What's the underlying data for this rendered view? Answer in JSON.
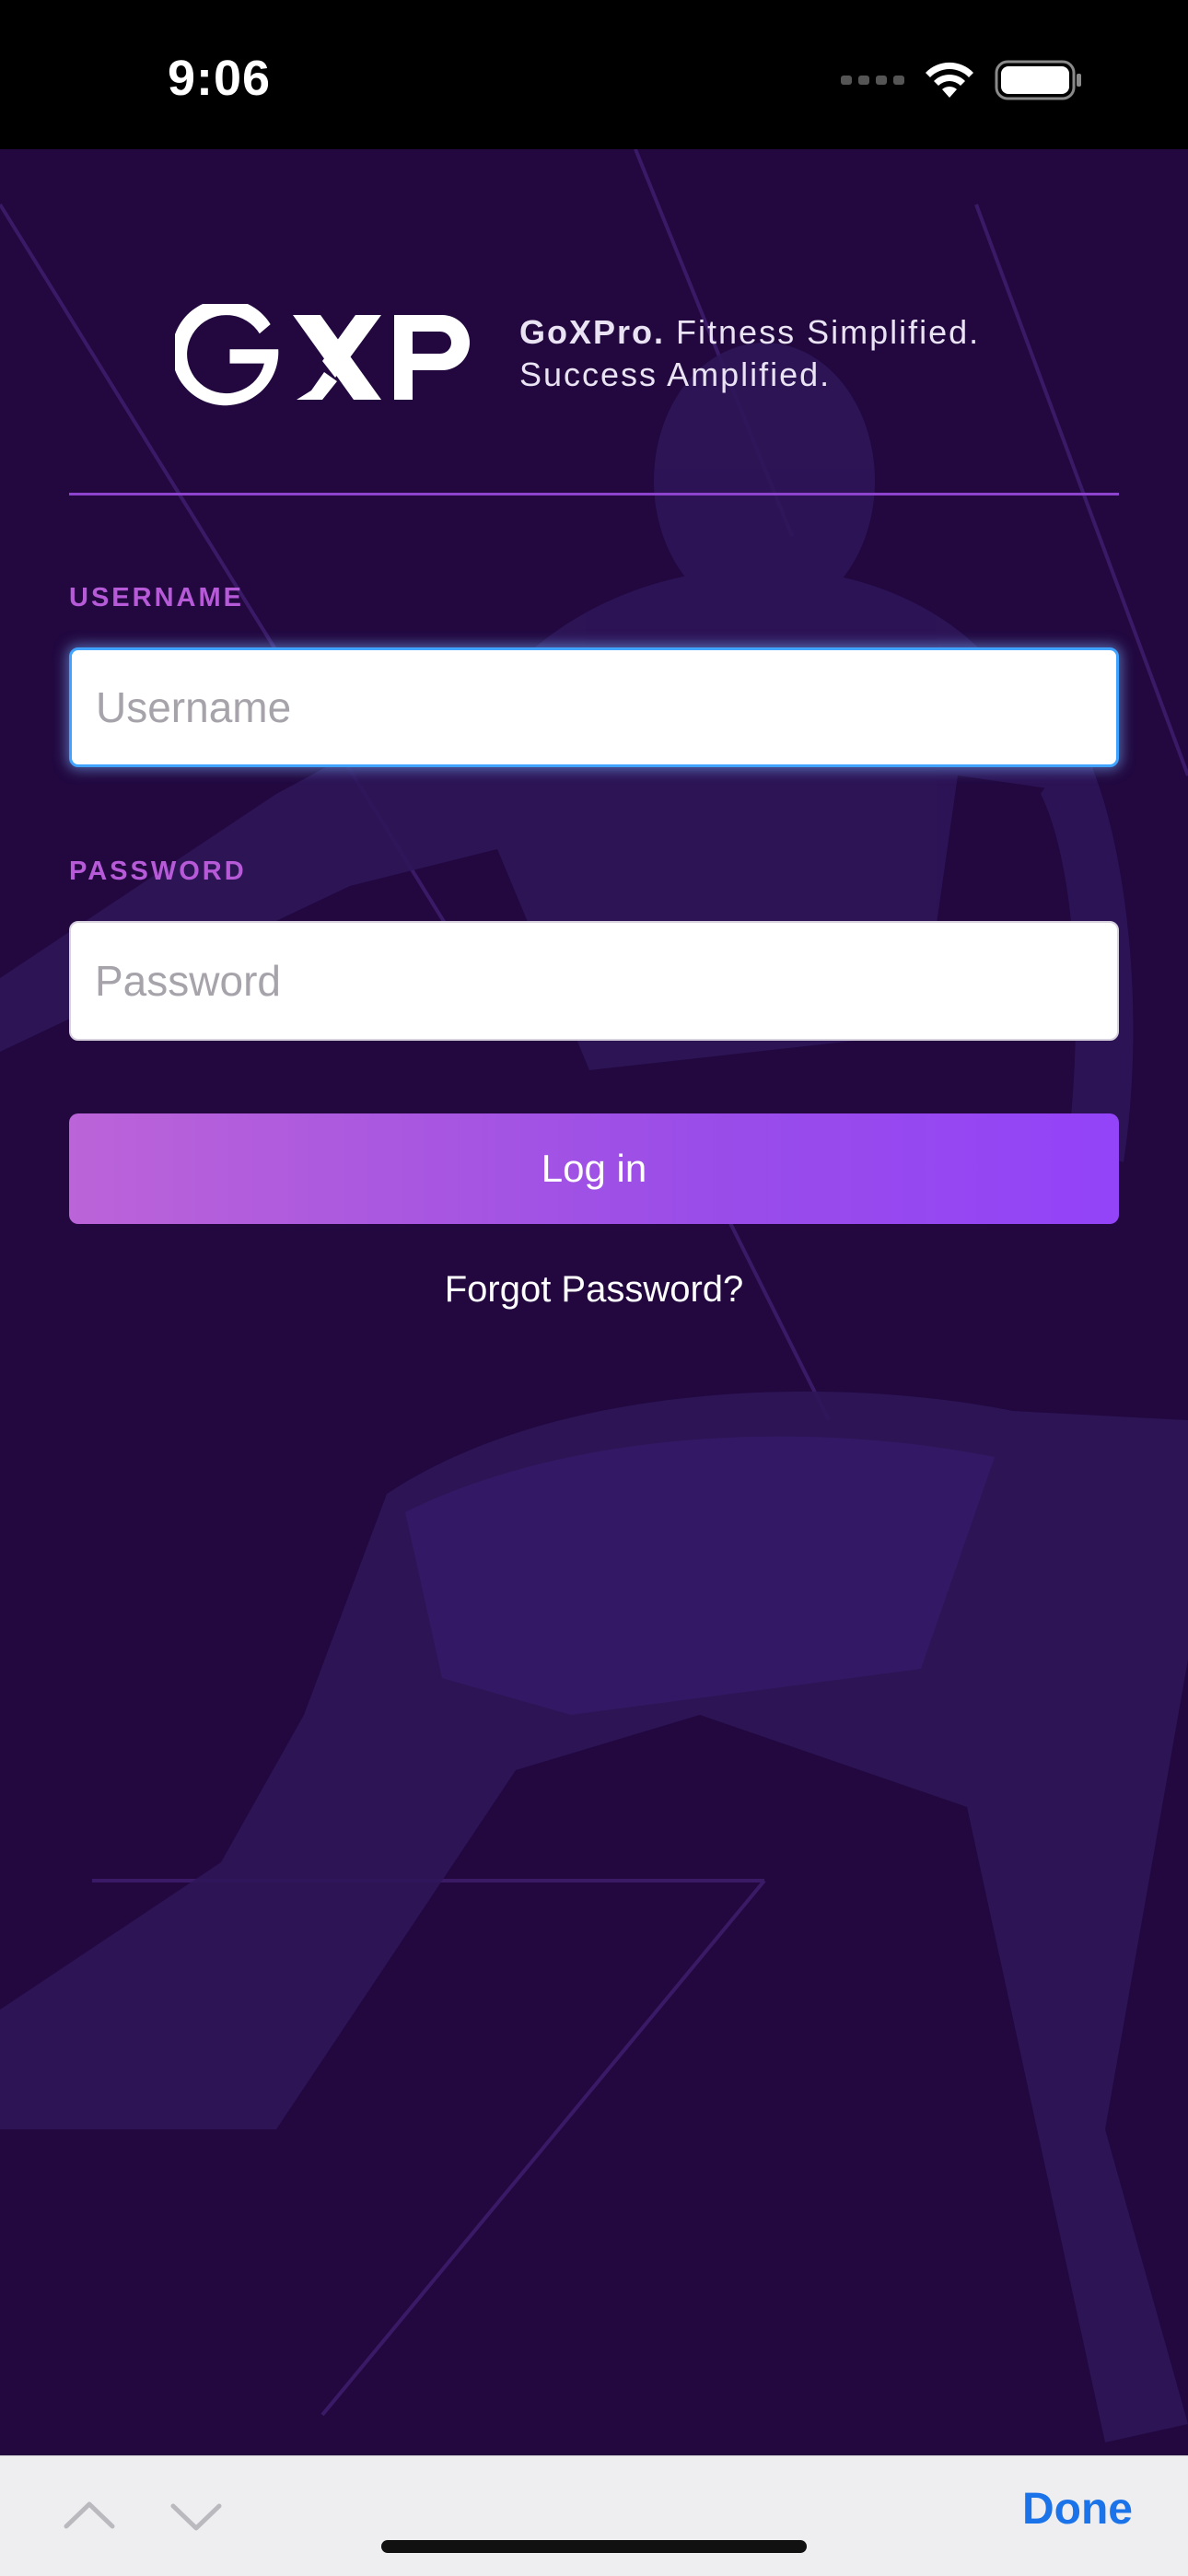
{
  "status_bar": {
    "time": "9:06"
  },
  "brand": {
    "logo_text": "GXP",
    "tagline_brand": "GoXPro.",
    "tagline_line1_rest": " Fitness Simplified.",
    "tagline_line2": "Success Amplified."
  },
  "form": {
    "username_label": "USERNAME",
    "username_placeholder": "Username",
    "username_value": "",
    "password_label": "PASSWORD",
    "password_placeholder": "Password",
    "password_value": "",
    "login_label": "Log in",
    "forgot_label": "Forgot Password?"
  },
  "keyboard_bar": {
    "done_label": "Done"
  },
  "colors": {
    "background": "#22083f",
    "accent": "#9343f8",
    "label": "#b65ad8",
    "focus_ring": "#3fa3ff",
    "done": "#1a73e8"
  },
  "icons": [
    "wifi-icon",
    "battery-icon",
    "chevron-up-icon",
    "chevron-down-icon"
  ]
}
